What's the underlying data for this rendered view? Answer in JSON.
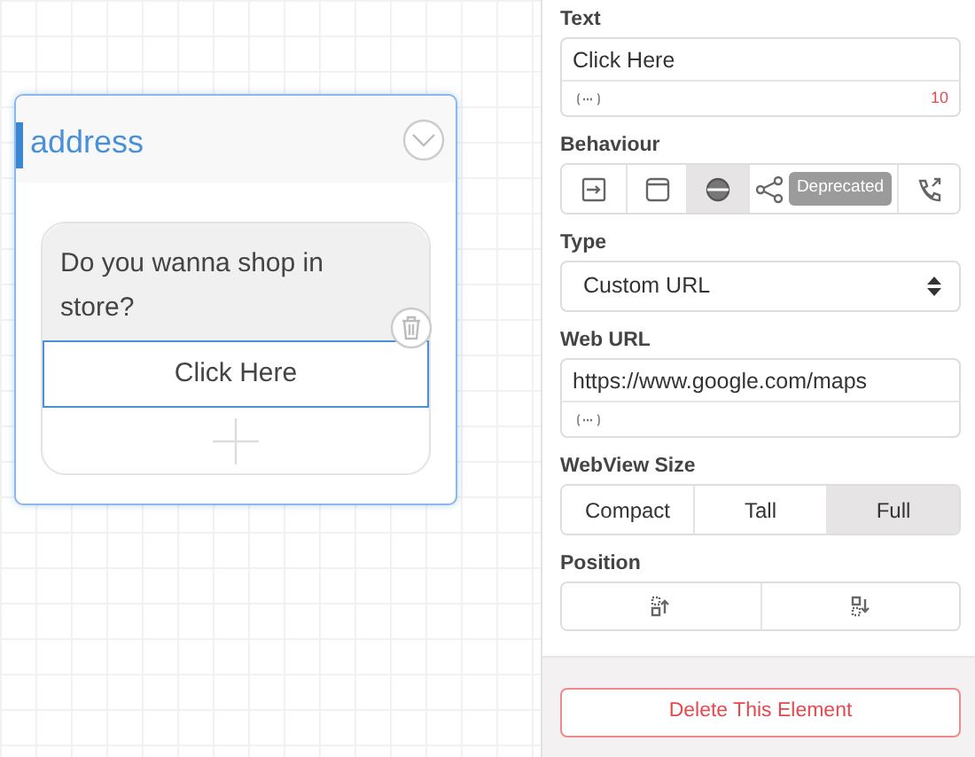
{
  "card": {
    "title": "address",
    "selected": true,
    "message": "Do you wanna shop in store?",
    "buttons": [
      {
        "label": "Click Here",
        "selected": true
      }
    ]
  },
  "panel": {
    "text_field": {
      "label": "Text",
      "value": "Click Here",
      "counter": "10"
    },
    "behaviour": {
      "label": "Behaviour",
      "options": [
        {
          "kind": "postback",
          "selected": false
        },
        {
          "kind": "window",
          "selected": false
        },
        {
          "kind": "web",
          "selected": true
        },
        {
          "kind": "share",
          "selected": false,
          "badge": "Deprecated"
        },
        {
          "kind": "call",
          "selected": false
        }
      ]
    },
    "type": {
      "label": "Type",
      "value": "Custom URL"
    },
    "web_url": {
      "label": "Web URL",
      "value": "https://www.google.com/maps"
    },
    "webview_size": {
      "label": "WebView Size",
      "options": [
        {
          "label": "Compact",
          "selected": false
        },
        {
          "label": "Tall",
          "selected": false
        },
        {
          "label": "Full",
          "selected": true
        }
      ]
    },
    "position": {
      "label": "Position",
      "options": [
        {
          "kind": "move-up"
        },
        {
          "kind": "move-down"
        }
      ]
    },
    "delete_button": "Delete This Element"
  }
}
